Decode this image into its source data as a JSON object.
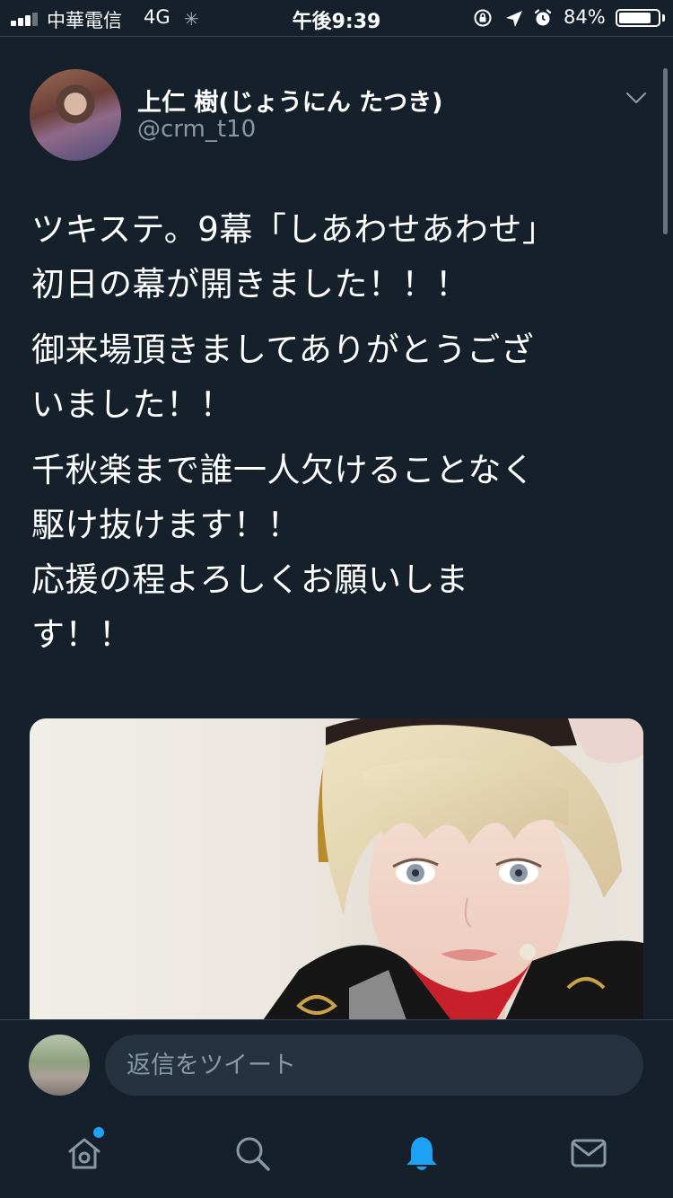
{
  "status_bar": {
    "carrier": "中華電信",
    "network": "4G",
    "time": "午後9:39",
    "battery_percent_label": "84%",
    "battery_level": 0.84
  },
  "tweet": {
    "author_name": "上仁 樹(じょうにん たつき)",
    "handle": "@crm_t10",
    "paragraphs": [
      "ツキステ。9幕「しあわせあわせ」\n初日の幕が開きました！！！",
      "御来場頂きましてありがとうござ\nいました！！",
      "千秋楽まで誰一人欠けることなく\n駆け抜けます！！\n応援の程よろしくお願いしま\nす！！"
    ]
  },
  "reply": {
    "placeholder": "返信をツイート"
  },
  "tabs": {
    "home": "home-icon",
    "search": "search-icon",
    "notifications": "bell-icon",
    "messages": "mail-icon"
  },
  "colors": {
    "background": "#15202b",
    "accent": "#1da1f2",
    "secondary_text": "#8899a6",
    "input_bg": "#253341"
  }
}
